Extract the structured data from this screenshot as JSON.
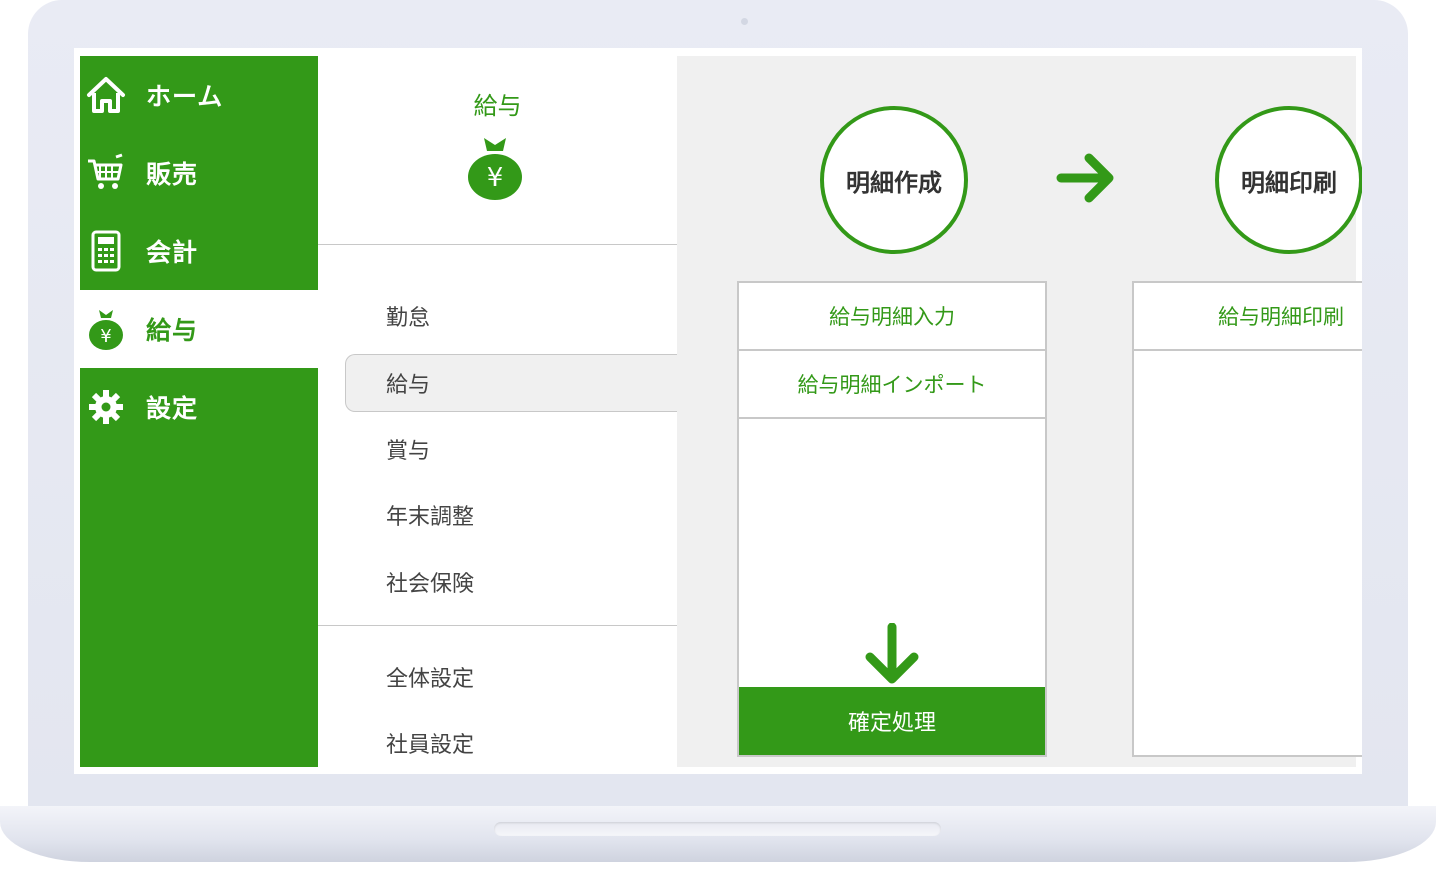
{
  "sidebar": {
    "items": [
      {
        "label": "ホーム",
        "icon": "home-icon"
      },
      {
        "label": "販売",
        "icon": "cart-icon"
      },
      {
        "label": "会計",
        "icon": "calculator-icon"
      },
      {
        "label": "給与",
        "icon": "money-bag-icon",
        "active": true
      },
      {
        "label": "設定",
        "icon": "gear-icon"
      }
    ]
  },
  "submenu": {
    "title": "給与",
    "yen_symbol": "¥",
    "items": [
      "勤怠",
      "給与",
      "賞与",
      "年末調整",
      "社会保険"
    ],
    "selected": "給与",
    "settings_items": [
      "全体設定",
      "社員設定"
    ]
  },
  "main": {
    "steps": [
      {
        "title": "明細作成",
        "actions": [
          "給与明細入力",
          "給与明細インポート"
        ],
        "confirm_label": "確定処理"
      },
      {
        "title": "明細印刷",
        "actions": [
          "給与明細印刷"
        ]
      }
    ]
  },
  "colors": {
    "brand_green": "#339918",
    "panel_gray": "#f0f0f0",
    "border_gray": "#c8c8c8"
  }
}
